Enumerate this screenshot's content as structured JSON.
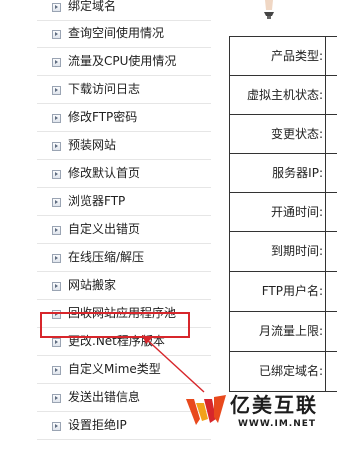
{
  "sidebar": {
    "items": [
      {
        "label": "绑定域名"
      },
      {
        "label": "查询空间使用情况"
      },
      {
        "label": "流量及CPU使用情况"
      },
      {
        "label": "下载访问日志"
      },
      {
        "label": "修改FTP密码"
      },
      {
        "label": "预装网站"
      },
      {
        "label": "修改默认首页"
      },
      {
        "label": "浏览器FTP"
      },
      {
        "label": "自定义出错页"
      },
      {
        "label": "在线压缩/解压"
      },
      {
        "label": "网站搬家"
      },
      {
        "label": "回收网站应用程序池"
      },
      {
        "label": "更改.Net程序版本"
      },
      {
        "label": "自定义Mime类型"
      },
      {
        "label": "发送出错信息"
      },
      {
        "label": "设置拒绝IP"
      }
    ],
    "highlighted_item": "回收网站应用程序池",
    "highlight_color": "#d7262b"
  },
  "info_table": {
    "rows": [
      {
        "label": "产品类型:"
      },
      {
        "label": "虚拟主机状态:"
      },
      {
        "label": "变更状态:"
      },
      {
        "label": "服务器IP:"
      },
      {
        "label": "开通时间:"
      },
      {
        "label": "到期时间:"
      },
      {
        "label": "FTP用户名:"
      },
      {
        "label": "月流量上限:"
      },
      {
        "label": "已绑定域名:"
      }
    ]
  },
  "watermark": {
    "title": "亿美互联",
    "url": "WWW.IM.NET",
    "logo_colors": [
      "#e8491d",
      "#f2a21a",
      "#d7262b"
    ]
  }
}
